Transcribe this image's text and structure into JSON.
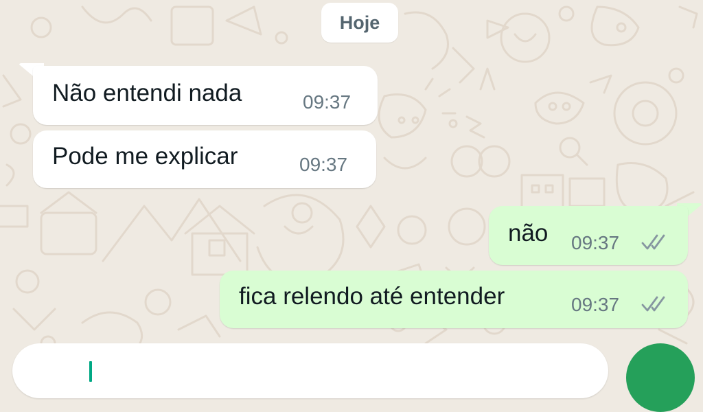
{
  "chat": {
    "date_separator": "Hoje",
    "messages": [
      {
        "direction": "incoming",
        "text": "Não entendi nada",
        "time": "09:37"
      },
      {
        "direction": "incoming",
        "text": "Pode me explicar",
        "time": "09:37"
      },
      {
        "direction": "outgoing",
        "text": "não",
        "time": "09:37",
        "status_icon": "double-check-icon"
      },
      {
        "direction": "outgoing",
        "text": "fica relendo até entender",
        "time": "09:37",
        "status_icon": "double-check-icon"
      }
    ]
  },
  "composer": {
    "send_icon": "send-button"
  },
  "colors": {
    "background": "#efeae2",
    "incoming_bubble": "#ffffff",
    "outgoing_bubble": "#d9fdd3",
    "accent": "#25a05a"
  }
}
